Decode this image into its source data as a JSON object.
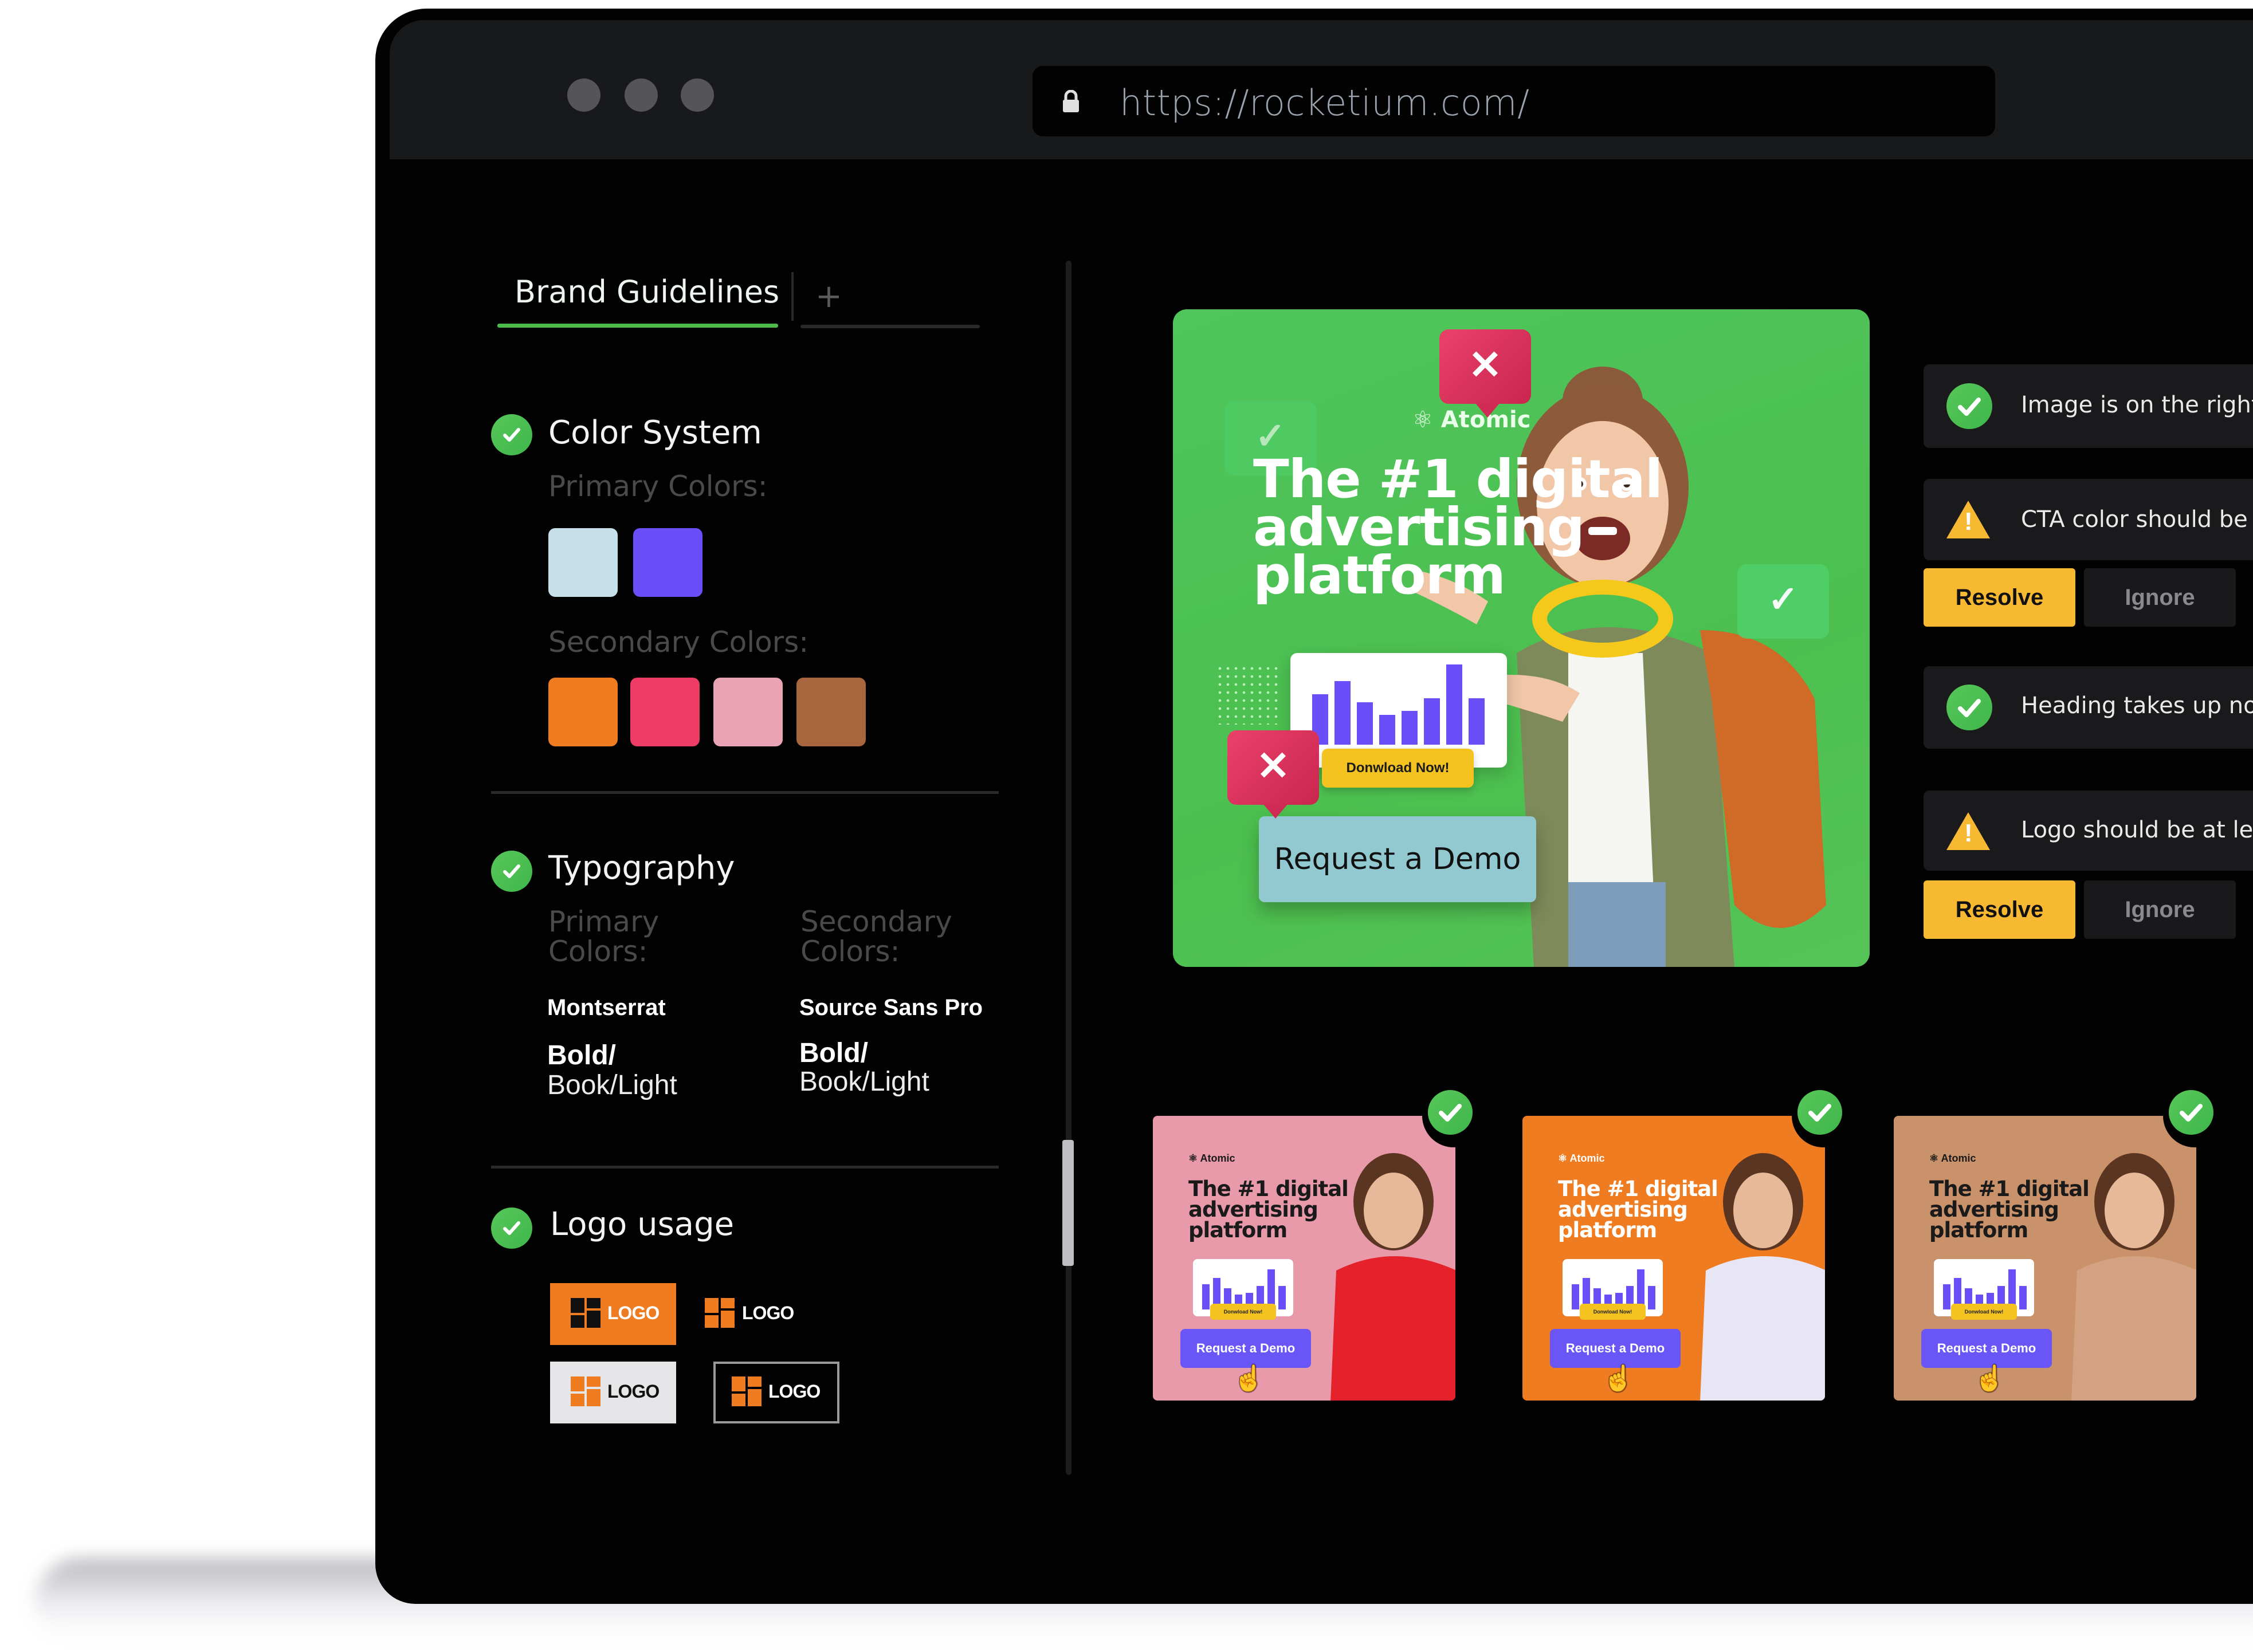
{
  "browser": {
    "url": "https://rocketium.com/",
    "lock_icon": "lock-icon",
    "window_controls": [
      "close",
      "minimize",
      "maximize"
    ]
  },
  "left_panel": {
    "tabs": [
      {
        "label": "Brand Guidelines",
        "active": true
      },
      {
        "label": "+",
        "active": false
      }
    ],
    "sections": {
      "color_system": {
        "title": "Color System",
        "status": "passed",
        "primary_label": "Primary Colors:",
        "primary_colors": [
          "#c7dfe9",
          "#6a4ff8"
        ],
        "secondary_label": "Secondary Colors:",
        "secondary_colors": [
          "#f07c22",
          "#ef3c67",
          "#eaa3b5",
          "#a8663f"
        ]
      },
      "typography": {
        "title": "Typography",
        "status": "passed",
        "primary_label": "Primary Colors:",
        "secondary_label": "Secondary Colors:",
        "primary_font": "Montserrat",
        "secondary_font": "Source Sans Pro",
        "primary_weights_bold": "Bold/",
        "primary_weights_light": "Book/Light",
        "secondary_weights_bold": "Bold/",
        "secondary_weights_light": "Book/Light"
      },
      "logo_usage": {
        "title": "Logo usage",
        "status": "passed",
        "variants": [
          {
            "label": "LOGO",
            "style": "orange-bg"
          },
          {
            "label": "LOGO",
            "style": "dark-no-border"
          },
          {
            "label": "LOGO",
            "style": "light-bg"
          },
          {
            "label": "LOGO",
            "style": "dark-bordered"
          }
        ]
      }
    }
  },
  "main_ad": {
    "brand": "Atomic",
    "headline": [
      "The #1 digital",
      "advertising",
      "platform"
    ],
    "secondary_cta": "Donwload Now!",
    "primary_cta": "Request a Demo",
    "background_color": "#4fc55c",
    "annotations": [
      {
        "type": "error",
        "target": "logo"
      },
      {
        "type": "ok",
        "target": "headline"
      },
      {
        "type": "ok",
        "target": "image"
      },
      {
        "type": "error",
        "target": "cta"
      }
    ]
  },
  "checks": [
    {
      "status": "passed",
      "text": "Image is on the right"
    },
    {
      "status": "warning",
      "text": "CTA color should be",
      "actions": [
        "Resolve",
        "Ignore"
      ]
    },
    {
      "status": "passed",
      "text": "Heading takes up no"
    },
    {
      "status": "warning",
      "text": "Logo should be at le",
      "actions": [
        "Resolve",
        "Ignore"
      ]
    }
  ],
  "variants": [
    {
      "bg": "#e89aab",
      "text_color": "#1a1a1a",
      "brand": "Atomic",
      "headline": [
        "The #1 digital",
        "advertising",
        "platform"
      ],
      "secondary_cta": "Donwload Now!",
      "cta": "Request a Demo",
      "status": "passed",
      "subject_color": "#e5222b"
    },
    {
      "bg": "#f07c22",
      "text_color": "#ffffff",
      "brand": "Atomic",
      "headline": [
        "The #1 digital",
        "advertising",
        "platform"
      ],
      "secondary_cta": "Donwload Now!",
      "cta": "Request a Demo",
      "status": "passed",
      "subject_color": "#e8e6f4"
    },
    {
      "bg": "#c9926a",
      "text_color": "#1a1a1a",
      "brand": "Atomic",
      "headline": [
        "The #1 digital",
        "advertising",
        "platform"
      ],
      "secondary_cta": "Donwload Now!",
      "cta": "Request a Demo",
      "status": "passed",
      "subject_color": "#d4a283"
    }
  ],
  "chart_values": [
    60,
    75,
    50,
    35,
    40,
    55,
    95,
    55
  ]
}
